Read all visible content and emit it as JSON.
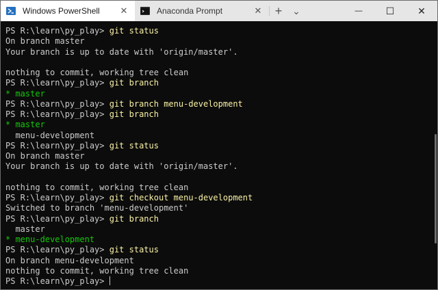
{
  "tabs": [
    {
      "label": "Windows PowerShell",
      "close": "✕",
      "active": true
    },
    {
      "label": "Anaconda Prompt",
      "close": "✕",
      "active": false
    }
  ],
  "toolbar": {
    "new_tab": "+",
    "dropdown": "⌄"
  },
  "window_controls": {
    "minimize": "—",
    "maximize": "☐",
    "close": "✕"
  },
  "terminal": {
    "prompt": "PS R:\\learn\\py_play> ",
    "lines": [
      {
        "type": "cmd",
        "command": "git status"
      },
      {
        "type": "out",
        "text": "On branch master"
      },
      {
        "type": "out",
        "text": "Your branch is up to date with 'origin/master'."
      },
      {
        "type": "out",
        "text": ""
      },
      {
        "type": "out",
        "text": "nothing to commit, working tree clean"
      },
      {
        "type": "cmd",
        "command": "git branch"
      },
      {
        "type": "current",
        "text": "* master"
      },
      {
        "type": "cmd",
        "command": "git branch menu-development"
      },
      {
        "type": "cmd",
        "command": "git branch"
      },
      {
        "type": "current",
        "text": "* master"
      },
      {
        "type": "out",
        "text": "  menu-development"
      },
      {
        "type": "cmd",
        "command": "git status"
      },
      {
        "type": "out",
        "text": "On branch master"
      },
      {
        "type": "out",
        "text": "Your branch is up to date with 'origin/master'."
      },
      {
        "type": "out",
        "text": ""
      },
      {
        "type": "out",
        "text": "nothing to commit, working tree clean"
      },
      {
        "type": "cmd",
        "command": "git checkout menu-development"
      },
      {
        "type": "out",
        "text": "Switched to branch 'menu-development'"
      },
      {
        "type": "cmd",
        "command": "git branch"
      },
      {
        "type": "out",
        "text": "  master"
      },
      {
        "type": "current",
        "text": "* menu-development"
      },
      {
        "type": "cmd",
        "command": "git status"
      },
      {
        "type": "out",
        "text": "On branch menu-development"
      },
      {
        "type": "out",
        "text": "nothing to commit, working tree clean"
      },
      {
        "type": "prompt",
        "text": ""
      }
    ]
  },
  "colors": {
    "background": "#0c0c0c",
    "foreground": "#cccccc",
    "command": "#f9f1a5",
    "current_branch": "#16c60c",
    "tab_bar": "#e6e6e6",
    "active_tab": "#ffffff"
  }
}
